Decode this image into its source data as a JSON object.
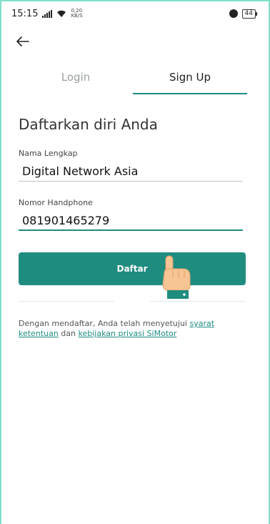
{
  "status_bar": {
    "time": "15:15",
    "speed": "0,20",
    "speed_unit": "KB/S",
    "battery": "44"
  },
  "tabs": [
    {
      "label": "Login",
      "active": false
    },
    {
      "label": "Sign Up",
      "active": true
    }
  ],
  "form": {
    "heading": "Daftarkan diri Anda",
    "name_label": "Nama Lengkap",
    "name_value": "Digital Network Asia",
    "phone_label": "Nomor Handphone",
    "phone_value": "081901465279",
    "submit_label": "Daftar"
  },
  "terms": {
    "prefix": "Dengan mendaftar, Anda telah menyetujui ",
    "link1": "syarat ketentuan",
    "middle": " dan ",
    "link2": "kebijakan privasi SiMotor"
  },
  "colors": {
    "primary": "#1f8c80",
    "frame": "#7fe1c9"
  },
  "icons": [
    "back-arrow-icon",
    "signal-icon",
    "wifi-icon",
    "alarm-icon",
    "battery-icon",
    "pointing-hand-icon"
  ]
}
